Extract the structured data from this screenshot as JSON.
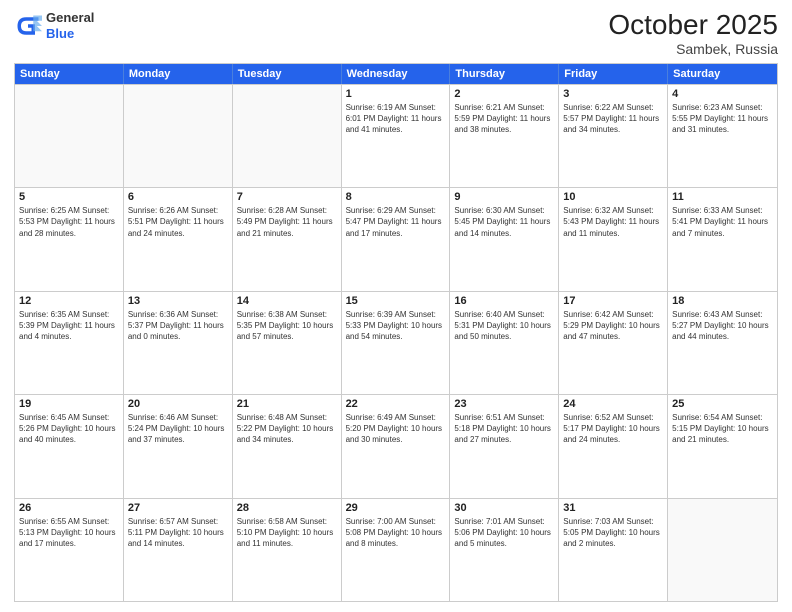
{
  "header": {
    "logo_general": "General",
    "logo_blue": "Blue",
    "month": "October 2025",
    "location": "Sambek, Russia"
  },
  "days_of_week": [
    "Sunday",
    "Monday",
    "Tuesday",
    "Wednesday",
    "Thursday",
    "Friday",
    "Saturday"
  ],
  "weeks": [
    [
      {
        "day": "",
        "info": ""
      },
      {
        "day": "",
        "info": ""
      },
      {
        "day": "",
        "info": ""
      },
      {
        "day": "1",
        "info": "Sunrise: 6:19 AM\nSunset: 6:01 PM\nDaylight: 11 hours and 41 minutes."
      },
      {
        "day": "2",
        "info": "Sunrise: 6:21 AM\nSunset: 5:59 PM\nDaylight: 11 hours and 38 minutes."
      },
      {
        "day": "3",
        "info": "Sunrise: 6:22 AM\nSunset: 5:57 PM\nDaylight: 11 hours and 34 minutes."
      },
      {
        "day": "4",
        "info": "Sunrise: 6:23 AM\nSunset: 5:55 PM\nDaylight: 11 hours and 31 minutes."
      }
    ],
    [
      {
        "day": "5",
        "info": "Sunrise: 6:25 AM\nSunset: 5:53 PM\nDaylight: 11 hours and 28 minutes."
      },
      {
        "day": "6",
        "info": "Sunrise: 6:26 AM\nSunset: 5:51 PM\nDaylight: 11 hours and 24 minutes."
      },
      {
        "day": "7",
        "info": "Sunrise: 6:28 AM\nSunset: 5:49 PM\nDaylight: 11 hours and 21 minutes."
      },
      {
        "day": "8",
        "info": "Sunrise: 6:29 AM\nSunset: 5:47 PM\nDaylight: 11 hours and 17 minutes."
      },
      {
        "day": "9",
        "info": "Sunrise: 6:30 AM\nSunset: 5:45 PM\nDaylight: 11 hours and 14 minutes."
      },
      {
        "day": "10",
        "info": "Sunrise: 6:32 AM\nSunset: 5:43 PM\nDaylight: 11 hours and 11 minutes."
      },
      {
        "day": "11",
        "info": "Sunrise: 6:33 AM\nSunset: 5:41 PM\nDaylight: 11 hours and 7 minutes."
      }
    ],
    [
      {
        "day": "12",
        "info": "Sunrise: 6:35 AM\nSunset: 5:39 PM\nDaylight: 11 hours and 4 minutes."
      },
      {
        "day": "13",
        "info": "Sunrise: 6:36 AM\nSunset: 5:37 PM\nDaylight: 11 hours and 0 minutes."
      },
      {
        "day": "14",
        "info": "Sunrise: 6:38 AM\nSunset: 5:35 PM\nDaylight: 10 hours and 57 minutes."
      },
      {
        "day": "15",
        "info": "Sunrise: 6:39 AM\nSunset: 5:33 PM\nDaylight: 10 hours and 54 minutes."
      },
      {
        "day": "16",
        "info": "Sunrise: 6:40 AM\nSunset: 5:31 PM\nDaylight: 10 hours and 50 minutes."
      },
      {
        "day": "17",
        "info": "Sunrise: 6:42 AM\nSunset: 5:29 PM\nDaylight: 10 hours and 47 minutes."
      },
      {
        "day": "18",
        "info": "Sunrise: 6:43 AM\nSunset: 5:27 PM\nDaylight: 10 hours and 44 minutes."
      }
    ],
    [
      {
        "day": "19",
        "info": "Sunrise: 6:45 AM\nSunset: 5:26 PM\nDaylight: 10 hours and 40 minutes."
      },
      {
        "day": "20",
        "info": "Sunrise: 6:46 AM\nSunset: 5:24 PM\nDaylight: 10 hours and 37 minutes."
      },
      {
        "day": "21",
        "info": "Sunrise: 6:48 AM\nSunset: 5:22 PM\nDaylight: 10 hours and 34 minutes."
      },
      {
        "day": "22",
        "info": "Sunrise: 6:49 AM\nSunset: 5:20 PM\nDaylight: 10 hours and 30 minutes."
      },
      {
        "day": "23",
        "info": "Sunrise: 6:51 AM\nSunset: 5:18 PM\nDaylight: 10 hours and 27 minutes."
      },
      {
        "day": "24",
        "info": "Sunrise: 6:52 AM\nSunset: 5:17 PM\nDaylight: 10 hours and 24 minutes."
      },
      {
        "day": "25",
        "info": "Sunrise: 6:54 AM\nSunset: 5:15 PM\nDaylight: 10 hours and 21 minutes."
      }
    ],
    [
      {
        "day": "26",
        "info": "Sunrise: 6:55 AM\nSunset: 5:13 PM\nDaylight: 10 hours and 17 minutes."
      },
      {
        "day": "27",
        "info": "Sunrise: 6:57 AM\nSunset: 5:11 PM\nDaylight: 10 hours and 14 minutes."
      },
      {
        "day": "28",
        "info": "Sunrise: 6:58 AM\nSunset: 5:10 PM\nDaylight: 10 hours and 11 minutes."
      },
      {
        "day": "29",
        "info": "Sunrise: 7:00 AM\nSunset: 5:08 PM\nDaylight: 10 hours and 8 minutes."
      },
      {
        "day": "30",
        "info": "Sunrise: 7:01 AM\nSunset: 5:06 PM\nDaylight: 10 hours and 5 minutes."
      },
      {
        "day": "31",
        "info": "Sunrise: 7:03 AM\nSunset: 5:05 PM\nDaylight: 10 hours and 2 minutes."
      },
      {
        "day": "",
        "info": ""
      }
    ]
  ]
}
